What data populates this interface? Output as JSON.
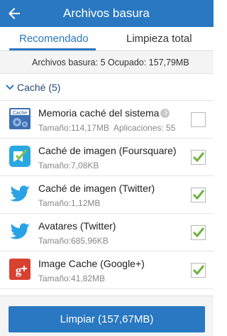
{
  "appbar": {
    "title": "Archivos basura"
  },
  "tabs": [
    {
      "label": "Recomendado"
    },
    {
      "label": "Limpieza total"
    }
  ],
  "summary": {
    "junk": "Archivos basura: 5",
    "used": "Ocupado: 157,79MB"
  },
  "section": {
    "title": "Caché (5)"
  },
  "items": [
    {
      "name": "Memoria caché del sistema",
      "size": "Tamaño:114,17MB",
      "apps": "Aplicaciones: 55",
      "icon": "cache-icon",
      "checked": false
    },
    {
      "name": "Caché de imagen (Foursquare)",
      "size": "Tamaño:7,08KB",
      "icon": "foursquare-icon",
      "checked": true
    },
    {
      "name": "Caché de imagen (Twitter)",
      "size": "Tamaño:1,12MB",
      "icon": "twitter-icon",
      "checked": true
    },
    {
      "name": "Avatares (Twitter)",
      "size": "Tamaño:685,96KB",
      "icon": "twitter-icon",
      "checked": true
    },
    {
      "name": "Image Cache (Google+)",
      "size": "Tamaño:41,82MB",
      "icon": "google-plus-icon",
      "checked": true
    }
  ],
  "action": {
    "label": "Limpiar (157,67MB)"
  },
  "icon_text": {
    "cache": "Cache"
  },
  "colors": {
    "accent": "#2a78c2",
    "check": "#6db33f"
  }
}
